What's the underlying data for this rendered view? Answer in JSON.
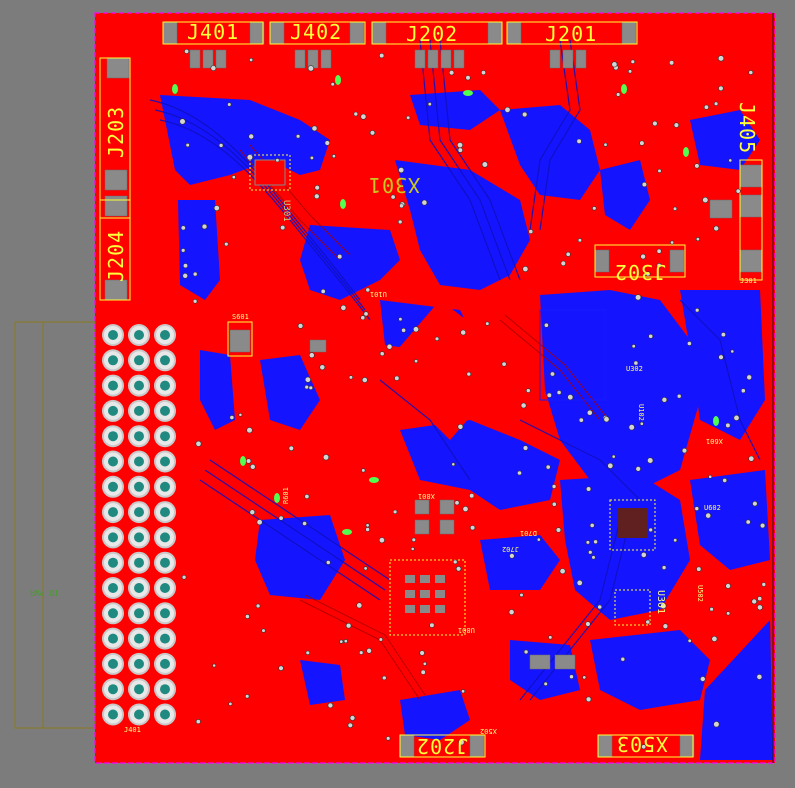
{
  "colors": {
    "background": "#7c7c7c",
    "copper_top": "#ff0000",
    "copper_bottom": "#1414ff",
    "silkscreen": "#ffff3a",
    "pad": "#8a8a8a",
    "via": "#cfcfcf",
    "outline": "#ff00ff"
  },
  "connectors": {
    "j401": "J401",
    "j402": "J402",
    "j202_top": "J202",
    "j201": "J201",
    "j203": "J203",
    "j204": "J204",
    "j405": "J405",
    "j302": "J302",
    "j202_bottom": "J202",
    "x503": "X503",
    "x301": "X301",
    "io_pwr": "IO PWR"
  },
  "small_labels": {
    "j301": "J301",
    "s601": "S601",
    "u302": "U302",
    "u102": "U102",
    "u602": "U602",
    "x601": "X601",
    "x801": "X801",
    "u801": "U801",
    "j702": "J702",
    "x502": "X502",
    "u301": "U301",
    "r601": "R601",
    "u502": "U502",
    "d701": "D701",
    "u101": "U101",
    "u301b": "U301",
    "j401s": "J401"
  },
  "header_pin_rows": 16,
  "header_pin_cols": 3
}
